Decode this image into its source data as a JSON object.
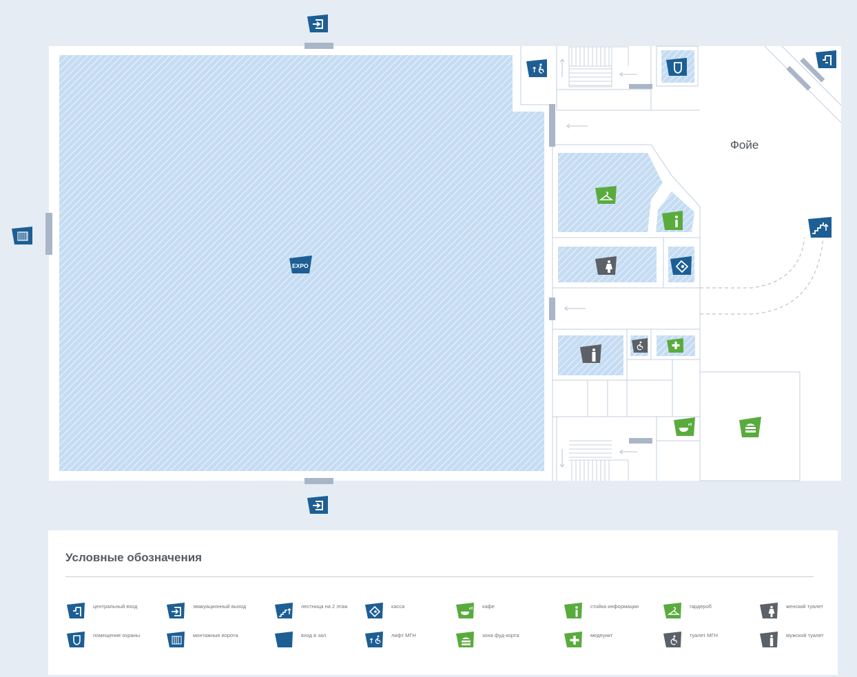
{
  "map": {
    "foyer_label": "Фойе",
    "colors": {
      "background": "#e5ecf4",
      "hall_fill": "#c5dcf3",
      "hatch": "#ffffff",
      "wall": "#c3cfdd",
      "door": "#a9b6c8",
      "blue_icon": "#1d5e94",
      "green_icon": "#5aab3e",
      "gray_icon": "#5b6166"
    },
    "icons": [
      {
        "name": "emergency-exit-icon",
        "type": "emergency_exit",
        "color": "blue"
      },
      {
        "name": "emergency-exit-icon",
        "type": "emergency_exit",
        "color": "blue"
      },
      {
        "name": "freight-gate-icon",
        "type": "freight_gate",
        "color": "blue"
      },
      {
        "name": "accessible-lift-icon",
        "type": "accessible_lift",
        "color": "blue"
      },
      {
        "name": "security-room-icon",
        "type": "security_room",
        "color": "blue"
      },
      {
        "name": "central-entrance-icon",
        "type": "central_entrance",
        "color": "blue"
      },
      {
        "name": "stairs-icon",
        "type": "stairs",
        "color": "blue"
      },
      {
        "name": "expo-hall-icon",
        "type": "expo",
        "color": "blue"
      },
      {
        "name": "cloakroom-icon",
        "type": "cloakroom",
        "color": "green"
      },
      {
        "name": "info-desk-icon",
        "type": "info_desk",
        "color": "green"
      },
      {
        "name": "womens-toilet-icon",
        "type": "womens_toilet",
        "color": "gray"
      },
      {
        "name": "ticket-office-icon",
        "type": "ticket_office",
        "color": "blue"
      },
      {
        "name": "mens-toilet-icon",
        "type": "mens_toilet",
        "color": "gray"
      },
      {
        "name": "accessible-toilet-icon",
        "type": "accessible_toilet",
        "color": "gray"
      },
      {
        "name": "first-aid-icon",
        "type": "first_aid",
        "color": "green"
      },
      {
        "name": "cafe-icon",
        "type": "cafe",
        "color": "green"
      },
      {
        "name": "food-court-icon",
        "type": "food_court",
        "color": "green"
      }
    ]
  },
  "legend": {
    "title": "Условные обозначения",
    "items": [
      {
        "icon": "central_entrance",
        "icon_name": "central-entrance-icon",
        "color": "blue",
        "label": "центральный вход"
      },
      {
        "icon": "emergency_exit",
        "icon_name": "emergency-exit-icon",
        "color": "blue",
        "label": "эвакуационный выход"
      },
      {
        "icon": "stairs",
        "icon_name": "stairs-icon",
        "color": "blue",
        "label": "лестница на 2 этаж"
      },
      {
        "icon": "ticket_office",
        "icon_name": "ticket-office-icon",
        "color": "blue",
        "label": "касса"
      },
      {
        "icon": "cafe",
        "icon_name": "cafe-icon",
        "color": "green",
        "label": "кафе"
      },
      {
        "icon": "info_desk",
        "icon_name": "info-desk-icon",
        "color": "green",
        "label": "стойка информации"
      },
      {
        "icon": "cloakroom",
        "icon_name": "cloakroom-icon",
        "color": "green",
        "label": "гардероб"
      },
      {
        "icon": "womens_toilet",
        "icon_name": "womens-toilet-icon",
        "color": "gray",
        "label": "женский туалет"
      },
      {
        "icon": "security_room",
        "icon_name": "security-room-icon",
        "color": "blue",
        "label": "помещение охраны"
      },
      {
        "icon": "freight_gate",
        "icon_name": "freight-gate-icon",
        "color": "blue",
        "label": "монтажные ворота"
      },
      {
        "icon": "hall_entrance",
        "icon_name": "hall-entrance-icon",
        "color": "blue",
        "label": "вход в зал"
      },
      {
        "icon": "accessible_lift",
        "icon_name": "accessible-lift-icon",
        "color": "blue",
        "label": "лифт МГН"
      },
      {
        "icon": "food_court",
        "icon_name": "food-court-icon",
        "color": "green",
        "label": "зона фуд-корта"
      },
      {
        "icon": "first_aid",
        "icon_name": "first-aid-icon",
        "color": "green",
        "label": "медпункт"
      },
      {
        "icon": "accessible_toilet",
        "icon_name": "accessible-toilet-icon",
        "color": "gray",
        "label": "туалет МГН"
      },
      {
        "icon": "mens_toilet",
        "icon_name": "mens-toilet-icon",
        "color": "gray",
        "label": "мужской туалет"
      }
    ]
  }
}
